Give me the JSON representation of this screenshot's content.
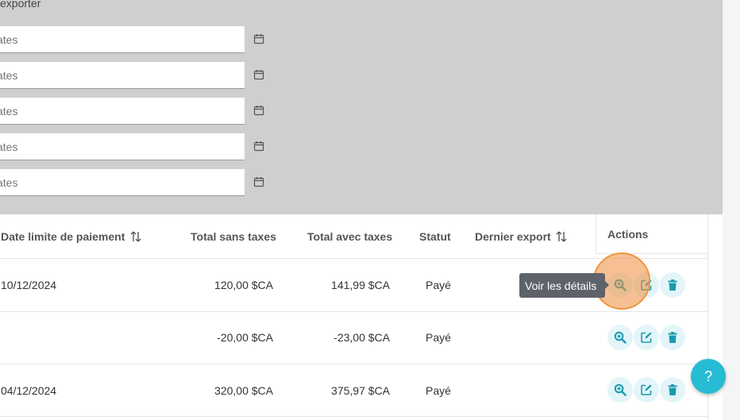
{
  "filters": {
    "export_label": "exporter",
    "date_placeholders": [
      "ates",
      "ates",
      "ates",
      "ates",
      "ates"
    ]
  },
  "table": {
    "headers": {
      "due_date": "Date limite de paiement",
      "total_excl": "Total sans taxes",
      "total_incl": "Total avec taxes",
      "status": "Statut",
      "last_export": "Dernier export",
      "actions": "Actions"
    },
    "rows": [
      {
        "due_date": "10/12/2024",
        "total_excl": "120,00 $CA",
        "total_incl": "141,99 $CA",
        "status": "Payé",
        "last_export": ""
      },
      {
        "due_date": "",
        "total_excl": "-20,00 $CA",
        "total_incl": "-23,00 $CA",
        "status": "Payé",
        "last_export": ""
      },
      {
        "due_date": "04/12/2024",
        "total_excl": "320,00 $CA",
        "total_incl": "375,97 $CA",
        "status": "Payé",
        "last_export": ""
      }
    ]
  },
  "tooltip": {
    "text": "Voir les détails"
  },
  "help": {
    "label": "?"
  },
  "colors": {
    "accent": "#26bcd3",
    "action_bg": "#e3f5f8",
    "action_icon": "#1a9bb0",
    "highlight": "#f0953f"
  }
}
